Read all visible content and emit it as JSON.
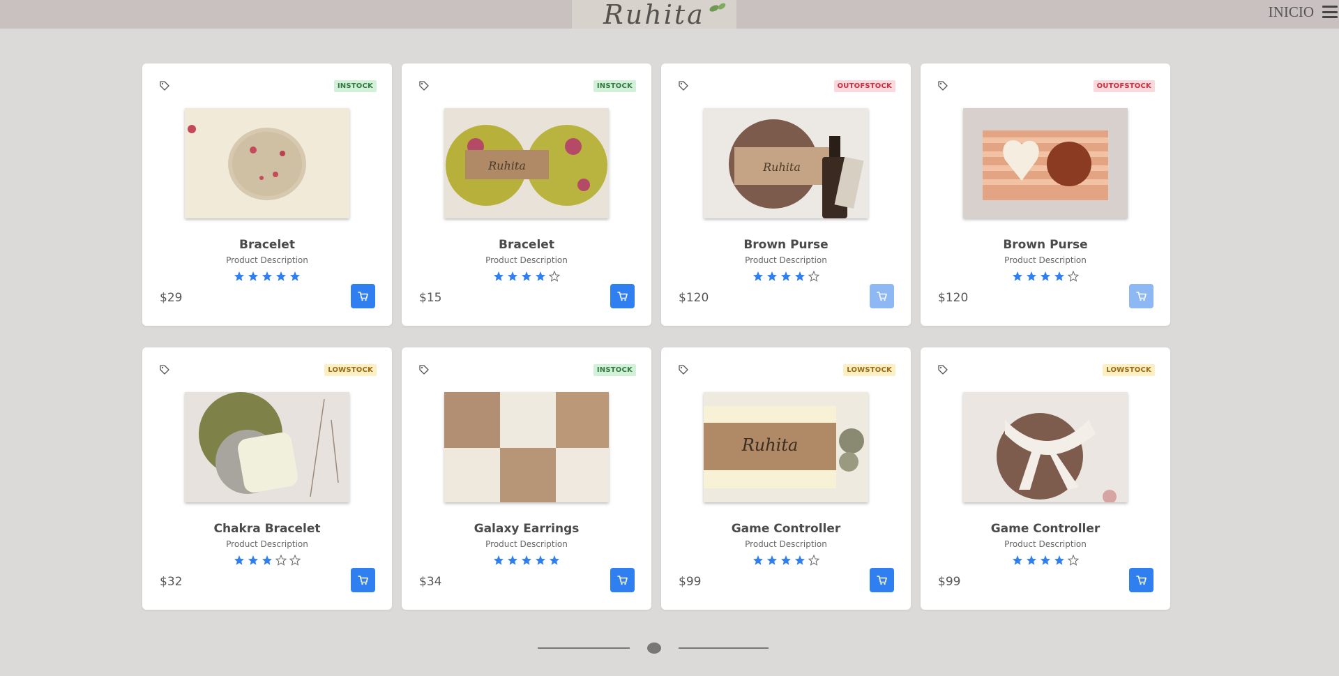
{
  "header": {
    "logo_text": "Ruhita",
    "nav_label": "INICIO"
  },
  "colors": {
    "accent": "#2f7ff0",
    "accent_disabled": "#8db8f4",
    "instock": "#2f7a3e",
    "outofstock": "#c4303f",
    "lowstock": "#9b6a12",
    "star": "#2f7ff0"
  },
  "products": [
    {
      "name": "Bracelet",
      "description": "Product Description",
      "price": "$29",
      "rating": 5,
      "stock": "INSTOCK",
      "stock_class": "in",
      "cart_enabled": true
    },
    {
      "name": "Bracelet",
      "description": "Product Description",
      "price": "$15",
      "rating": 4,
      "stock": "INSTOCK",
      "stock_class": "in",
      "cart_enabled": true
    },
    {
      "name": "Brown Purse",
      "description": "Product Description",
      "price": "$120",
      "rating": 4,
      "stock": "OUTOFSTOCK",
      "stock_class": "out",
      "cart_enabled": false
    },
    {
      "name": "Brown Purse",
      "description": "Product Description",
      "price": "$120",
      "rating": 4,
      "stock": "OUTOFSTOCK",
      "stock_class": "out",
      "cart_enabled": false
    },
    {
      "name": "Chakra Bracelet",
      "description": "Product Description",
      "price": "$32",
      "rating": 3,
      "stock": "LOWSTOCK",
      "stock_class": "low",
      "cart_enabled": true
    },
    {
      "name": "Galaxy Earrings",
      "description": "Product Description",
      "price": "$34",
      "rating": 5,
      "stock": "INSTOCK",
      "stock_class": "in",
      "cart_enabled": true
    },
    {
      "name": "Game Controller",
      "description": "Product Description",
      "price": "$99",
      "rating": 4,
      "stock": "LOWSTOCK",
      "stock_class": "low",
      "cart_enabled": true
    },
    {
      "name": "Game Controller",
      "description": "Product Description",
      "price": "$99",
      "rating": 4,
      "stock": "LOWSTOCK",
      "stock_class": "low",
      "cart_enabled": true
    }
  ],
  "icons": {
    "tag": "tag-icon",
    "cart": "cart-icon",
    "menu": "hamburger-menu-icon",
    "star_filled": "star-filled-icon",
    "star_empty": "star-empty-icon"
  }
}
